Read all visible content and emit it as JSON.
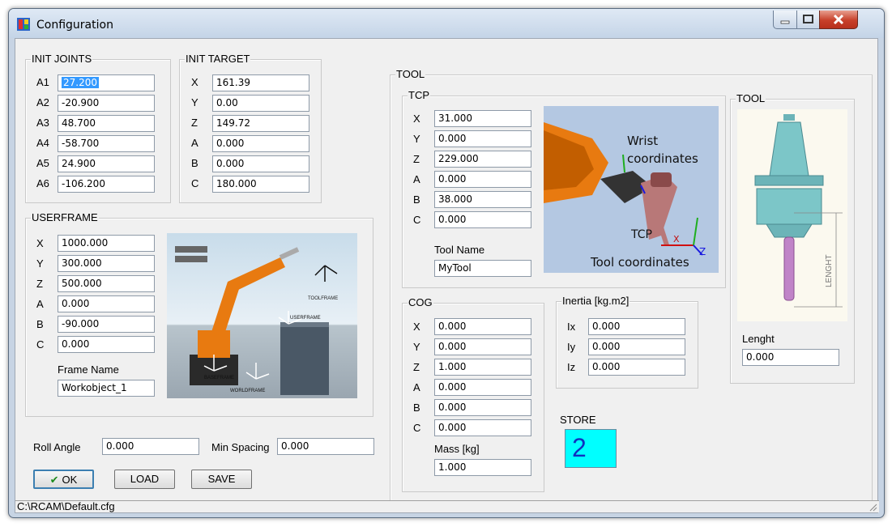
{
  "window": {
    "title": "Configuration"
  },
  "init_joints": {
    "title": "INIT JOINTS",
    "rows": [
      {
        "label": "A1",
        "value": "27.200"
      },
      {
        "label": "A2",
        "value": "-20.900"
      },
      {
        "label": "A3",
        "value": "48.700"
      },
      {
        "label": "A4",
        "value": "-58.700"
      },
      {
        "label": "A5",
        "value": "24.900"
      },
      {
        "label": "A6",
        "value": "-106.200"
      }
    ]
  },
  "init_target": {
    "title": "INIT TARGET",
    "rows": [
      {
        "label": "X",
        "value": "161.39"
      },
      {
        "label": "Y",
        "value": "0.00"
      },
      {
        "label": "Z",
        "value": "149.72"
      },
      {
        "label": "A",
        "value": "0.000"
      },
      {
        "label": "B",
        "value": "0.000"
      },
      {
        "label": "C",
        "value": "180.000"
      }
    ]
  },
  "userframe": {
    "title": "USERFRAME",
    "rows": [
      {
        "label": "X",
        "value": "1000.000"
      },
      {
        "label": "Y",
        "value": "300.000"
      },
      {
        "label": "Z",
        "value": "500.000"
      },
      {
        "label": "A",
        "value": "0.000"
      },
      {
        "label": "B",
        "value": "-90.000"
      },
      {
        "label": "C",
        "value": "0.000"
      }
    ],
    "frame_name_label": "Frame Name",
    "frame_name_value": "Workobject_1",
    "image_labels": {
      "toolframe": "TOOLFRAME",
      "userframe": "USERFRAME",
      "baseframe": "BASEFRAME",
      "worldframe": "WORLDFRAME"
    }
  },
  "bottom": {
    "roll_angle_label": "Roll Angle",
    "roll_angle_value": "0.000",
    "min_spacing_label": "Min Spacing",
    "min_spacing_value": "0.000",
    "ok_label": "OK",
    "load_label": "LOAD",
    "save_label": "SAVE"
  },
  "tool_group": {
    "title": "TOOL",
    "tcp": {
      "title": "TCP",
      "rows": [
        {
          "label": "X",
          "value": "31.000"
        },
        {
          "label": "Y",
          "value": "0.000"
        },
        {
          "label": "Z",
          "value": "229.000"
        },
        {
          "label": "A",
          "value": "0.000"
        },
        {
          "label": "B",
          "value": "38.000"
        },
        {
          "label": "C",
          "value": "0.000"
        }
      ],
      "tool_name_label": "Tool Name",
      "tool_name_value": "MyTool",
      "image_labels": {
        "wrist": "Wrist",
        "coordinates": "coordinates",
        "tcp": "TCP",
        "tool_coordinates": "Tool coordinates",
        "x": "X",
        "z": "Z"
      }
    },
    "tool_image": {
      "title": "TOOL",
      "length_label": "Lenght",
      "length_value": "0.000",
      "dimension_text": "LENGHT"
    },
    "cog": {
      "title": "COG",
      "rows": [
        {
          "label": "X",
          "value": "0.000"
        },
        {
          "label": "Y",
          "value": "0.000"
        },
        {
          "label": "Z",
          "value": "1.000"
        },
        {
          "label": "A",
          "value": "0.000"
        },
        {
          "label": "B",
          "value": "0.000"
        },
        {
          "label": "C",
          "value": "0.000"
        }
      ],
      "mass_label": "Mass [kg]",
      "mass_value": "1.000"
    },
    "inertia": {
      "title": "Inertia [kg.m2]",
      "rows": [
        {
          "label": "Ix",
          "value": "0.000"
        },
        {
          "label": "Iy",
          "value": "0.000"
        },
        {
          "label": "Iz",
          "value": "0.000"
        }
      ]
    },
    "store": {
      "label": "STORE",
      "value": "2"
    }
  },
  "status": {
    "path": "C:\\RCAM\\Default.cfg"
  },
  "colors": {
    "store_bg": "#00ffff",
    "store_text": "#1030c0",
    "robot_orange": "#e87a10",
    "selection": "#3399ff"
  }
}
